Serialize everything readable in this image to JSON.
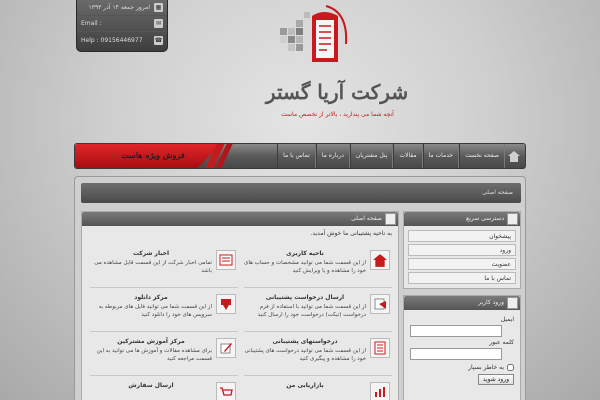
{
  "infobox": {
    "date": "امروز جمعه ۱۴ آذر ۱۳۹۳",
    "email": "Email :",
    "help": "Help : 09156446977"
  },
  "company": {
    "name": "شرکت آریا گستر",
    "slogan": "آنچه شما می پندارید ، بالاتر از تخصص ماست"
  },
  "promo": {
    "label": "فروش ویژه هاست"
  },
  "nav": {
    "items": [
      "صفحه نخست",
      "خدمات ما",
      "مقالات",
      "پنل مشتریان",
      "درباره ما",
      "تماس با ما"
    ]
  },
  "breadcrumb": {
    "label": "صفحه اصلی"
  },
  "main": {
    "title": "صفحه اصلی",
    "welcome": "به ناحیه پشتیبانی ما خوش آمدید.",
    "cards": [
      {
        "title": "ناحیه کاربری",
        "desc": "از این قسمت شما می توانید مشخصات و حساب های خود را مشاهده و یا ویرایش کنید",
        "icon": "home-icon"
      },
      {
        "title": "اخبار شرکت",
        "desc": "تمامی اخبار شرکت از این قسمت قابل مشاهده می باشد",
        "icon": "news-icon"
      },
      {
        "title": "ارسال درخواست پشتیبانی",
        "desc": "از این قسمت شما می توانید با استفاده از فرم درخواست (تیکت) درخواست خود را ارسال کنید",
        "icon": "ticket-icon"
      },
      {
        "title": "مرکز دانلود",
        "desc": "از این قسمت شما می توانید فایل های مربوطه به سرویس های خود را دانلود کنید",
        "icon": "download-icon"
      },
      {
        "title": "درخواستهای پشتیبانی",
        "desc": "از این قسمت شما می توانید درخواست های پشتیبانی خود را مشاهده و پیگیری کنید",
        "icon": "list-icon"
      },
      {
        "title": "مرکز آموزش مشترکین",
        "desc": "برای مشاهده مقالات و آموزش ها می توانید به این قسمت مراجعه کنید",
        "icon": "edit-icon"
      },
      {
        "title": "بازاریابی من",
        "desc": "",
        "icon": "chart-icon"
      },
      {
        "title": "ارسال سفارش",
        "desc": "",
        "icon": "cart-icon"
      }
    ]
  },
  "quick": {
    "title": "دسترسی سریع",
    "items": [
      "پیشخوان",
      "ورود",
      "عضویت",
      "تماس با ما"
    ]
  },
  "login": {
    "title": "ورود کاربر",
    "email_label": "ایمیل",
    "password_label": "کلمه عبور",
    "remember_label": "به خاطر بسپار",
    "submit_label": "ورود شوید"
  },
  "colors": {
    "accent": "#d3171c",
    "dark": "#4a4a4a"
  }
}
